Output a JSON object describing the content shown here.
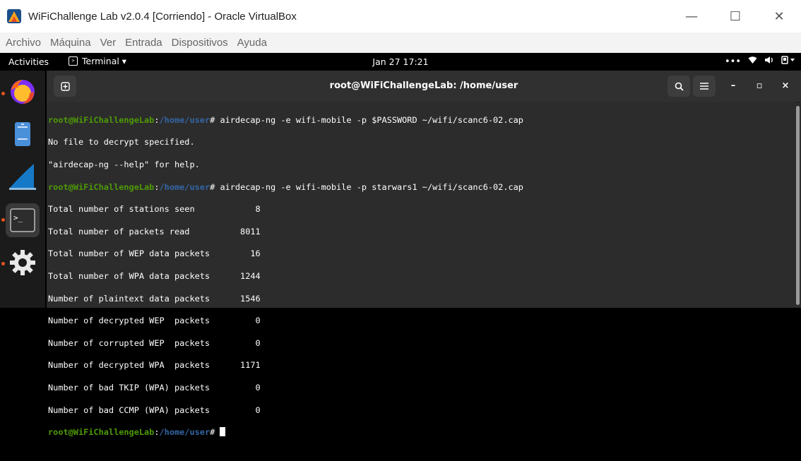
{
  "vbox": {
    "title": "WiFiChallenge Lab v2.0.4 [Corriendo] - Oracle VirtualBox",
    "menu": [
      "Archivo",
      "Máquina",
      "Ver",
      "Entrada",
      "Dispositivos",
      "Ayuda"
    ],
    "minimize": "—",
    "maximize": "☐",
    "close": "✕"
  },
  "topbar": {
    "activities": "Activities",
    "app_name": "Terminal ▾",
    "clock": "Jan 27  17:21",
    "status_more": "•••",
    "wifi": "ᯤ",
    "volume": "🔊",
    "power": "⏻ ▾"
  },
  "dock": {
    "items": [
      "firefox-icon",
      "files-icon",
      "wireshark-icon",
      "terminal-icon",
      "settings-icon"
    ]
  },
  "terminal": {
    "new_tab": "⊞",
    "title": "root@WiFiChallengeLab: /home/user",
    "search": "🔍",
    "menu": "≡",
    "minimize": "–",
    "maximize": "▫",
    "close": "×",
    "prompt_user": "root@WiFiChallengeLab",
    "prompt_sep": ":",
    "prompt_path": "/home/user",
    "prompt_end": "# ",
    "cmd1": "airdecap-ng -e wifi-mobile -p $PASSWORD ~/wifi/scanc6-02.cap",
    "out1": "No file to decrypt specified.",
    "out2": "\"airdecap-ng --help\" for help.",
    "cmd2": "airdecap-ng -e wifi-mobile -p starwars1 ~/wifi/scanc6-02.cap",
    "stats": [
      "Total number of stations seen            8",
      "Total number of packets read          8011",
      "Total number of WEP data packets        16",
      "Total number of WPA data packets      1244",
      "Number of plaintext data packets      1546",
      "Number of decrypted WEP  packets         0",
      "Number of corrupted WEP  packets         0",
      "Number of decrypted WPA  packets      1171",
      "Number of bad TKIP (WPA) packets         0",
      "Number of bad CCMP (WPA) packets         0"
    ]
  }
}
